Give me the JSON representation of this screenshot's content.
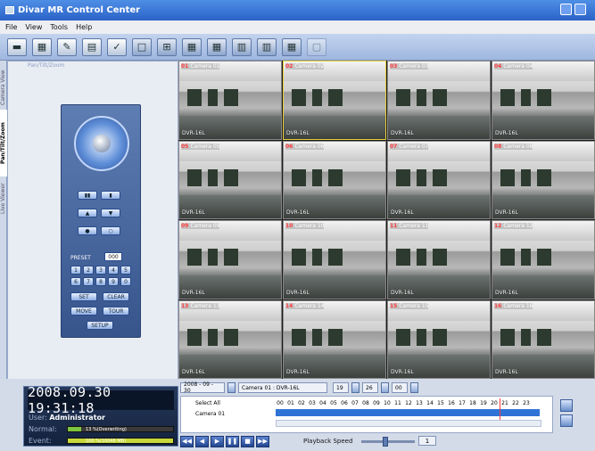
{
  "window": {
    "title": "Divar MR Control Center"
  },
  "menu": [
    "File",
    "View",
    "Tools",
    "Help"
  ],
  "side_tabs": [
    "Camera View",
    "Pan/Tilt/Zoom",
    "Live Viewer"
  ],
  "ptz": {
    "panel_title": "Pan/Tilt/Zoom",
    "preset_label": "PRESET",
    "preset_value": "000",
    "numbers": [
      "1",
      "2",
      "3",
      "4",
      "5",
      "6",
      "7",
      "8",
      "9",
      "0"
    ],
    "set_label": "SET",
    "clear_label": "CLEAR",
    "move_label": "MOVE",
    "tour_label": "TOUR",
    "setup_label": "SETUP"
  },
  "cameras": [
    {
      "num": "01",
      "name": "Camera 01",
      "dvr": "DVR-16L"
    },
    {
      "num": "02",
      "name": "Camera 02",
      "dvr": "DVR-16L"
    },
    {
      "num": "03",
      "name": "Camera 03",
      "dvr": "DVR-16L"
    },
    {
      "num": "04",
      "name": "Camera 04",
      "dvr": "DVR-16L"
    },
    {
      "num": "05",
      "name": "Camera 05",
      "dvr": "DVR-16L"
    },
    {
      "num": "06",
      "name": "Camera 06",
      "dvr": "DVR-16L"
    },
    {
      "num": "07",
      "name": "Camera 07",
      "dvr": "DVR-16L"
    },
    {
      "num": "08",
      "name": "Camera 08",
      "dvr": "DVR-16L"
    },
    {
      "num": "09",
      "name": "Camera 09",
      "dvr": "DVR-16L"
    },
    {
      "num": "10",
      "name": "Camera 10",
      "dvr": "DVR-16L"
    },
    {
      "num": "11",
      "name": "Camera 11",
      "dvr": "DVR-16L"
    },
    {
      "num": "12",
      "name": "Camera 12",
      "dvr": "DVR-16L"
    },
    {
      "num": "13",
      "name": "Camera 13",
      "dvr": "DVR-16L"
    },
    {
      "num": "14",
      "name": "Camera 14",
      "dvr": "DVR-16L"
    },
    {
      "num": "15",
      "name": "Camera 15",
      "dvr": "DVR-16L"
    },
    {
      "num": "16",
      "name": "Camera 16",
      "dvr": "DVR-16L"
    }
  ],
  "status": {
    "datetime": "2008.09.30  19:31:18",
    "user_label": "User:",
    "user": "Administrator",
    "normal_label": "Normal:",
    "normal_text": "13 %(Overwriting)",
    "normal_percent": 13,
    "event_label": "Event:",
    "event_text": "100 %(10048 MB)",
    "event_percent": 100
  },
  "playback": {
    "date": "2008 - 09 - 30",
    "camera": "Camera 01 : DVR-16L",
    "hour": "19",
    "minute": "26",
    "second": "00",
    "select_all": "Select All",
    "row_camera": "Camera 01",
    "hours": [
      "00",
      "01",
      "02",
      "03",
      "04",
      "05",
      "06",
      "07",
      "08",
      "09",
      "10",
      "11",
      "12",
      "13",
      "14",
      "15",
      "16",
      "17",
      "18",
      "19",
      "20",
      "21",
      "22",
      "23"
    ],
    "speed_label": "Playback Speed",
    "speed_value": "1"
  },
  "colors": {
    "title_bar": "#2b62c6",
    "normal_bar": "#7fc640",
    "event_bar": "#c8d83a",
    "timeline_bar": "#2f73d6",
    "cursor": "#ff3a3a"
  }
}
